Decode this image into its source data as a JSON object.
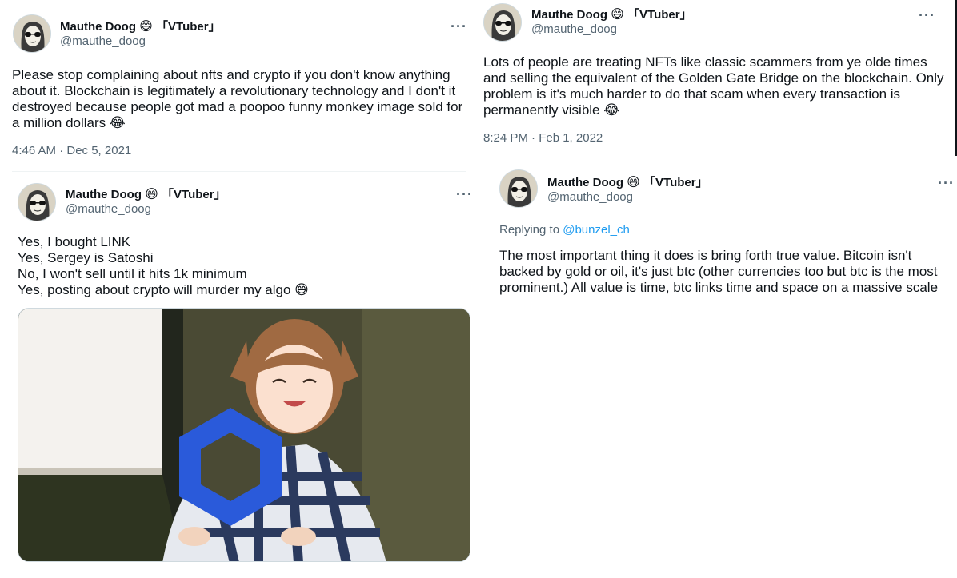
{
  "author": {
    "display_name": "Mauthe Doog",
    "emoji": "😄",
    "tag": "「VTuber」",
    "handle": "@mauthe_doog"
  },
  "more_label": "···",
  "tweets": [
    {
      "text": "Please stop complaining about nfts and crypto if you don't know anything about it. Blockchain is legitimately a revolutionary technology and I don't it destroyed because people got mad a poopoo funny monkey image sold for a million dollars 😂",
      "timestamp": "4:46 AM · Dec 5, 2021"
    },
    {
      "text": "Lots of people are treating NFTs like classic scammers from ye olde times and selling the equivalent of the Golden Gate Bridge on the blockchain. Only problem is it's much harder to do that scam when every transaction is permanently visible 😂",
      "timestamp": "8:24 PM · Feb 1, 2022"
    },
    {
      "lines": [
        "Yes, I bought LINK",
        "Yes, Sergey is Satoshi",
        "No, I won't sell until it hits 1k minimum",
        "Yes, posting about crypto will murder my algo 😅"
      ],
      "media_icon": "chainlink-hexagon-icon"
    },
    {
      "replying_label": "Replying to",
      "replying_handle": "@bunzel_ch",
      "text": "The most important thing it does is bring forth true value. Bitcoin isn't backed by gold or oil, it's just btc (other currencies too but btc is the most prominent.) All value is time, btc links time and space on a massive scale"
    }
  ],
  "colors": {
    "text": "#0f1419",
    "secondary": "#536471",
    "link": "#1d9bf0",
    "chainlink_blue": "#2a5ada"
  }
}
